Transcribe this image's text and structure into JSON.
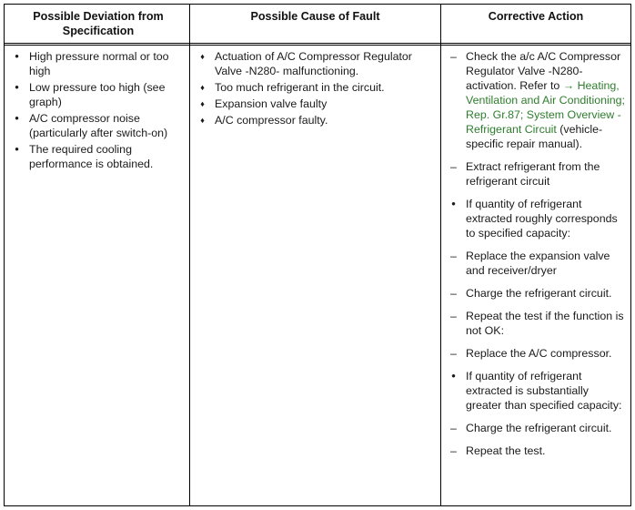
{
  "table": {
    "headers": [
      "Possible Deviation from Specification",
      "Possible Cause of Fault",
      "Corrective Action"
    ],
    "deviations": [
      "High pressure normal or too high",
      "Low pressure too high (see graph)",
      "A/C compressor noise (particularly after switch-on)",
      "The required cooling performance is obtained."
    ],
    "causes": [
      "Actuation of A/C Compressor Regulator Valve -N280- malfunctioning.",
      "Too much refrigerant in the circuit.",
      "Expansion valve faulty",
      "A/C compressor faulty."
    ],
    "actions": [
      {
        "marker": "dash",
        "text_before": "Check the a/c A/C Compressor Regulator Valve -N280- activation. Refer to",
        "link": "→ Heating, Ventilation and Air Conditioning; Rep. Gr.87; System Overview - Refrigerant Circuit",
        "text_after": " (vehicle-specific repair manual)."
      },
      {
        "marker": "dash",
        "text": "Extract refrigerant from the refrigerant circuit"
      },
      {
        "marker": "dot",
        "text": "If quantity of refrigerant extracted roughly corresponds to specified capacity:"
      },
      {
        "marker": "dash",
        "text": "Replace the expansion valve and receiver/dryer"
      },
      {
        "marker": "dash",
        "text": "Charge the refrigerant circuit."
      },
      {
        "marker": "dash",
        "text": "Repeat the test if the function is not OK:"
      },
      {
        "marker": "dash",
        "text": "Replace the A/C compressor."
      },
      {
        "marker": "dot",
        "text": "If quantity of refrigerant extracted is substantially greater than specified capacity:"
      },
      {
        "marker": "dash",
        "text": "Charge the refrigerant circuit."
      },
      {
        "marker": "dash",
        "text": "Repeat the test."
      }
    ],
    "colors": {
      "link": "#2e7d2e",
      "border": "#000000",
      "text": "#1a1a1a"
    }
  }
}
